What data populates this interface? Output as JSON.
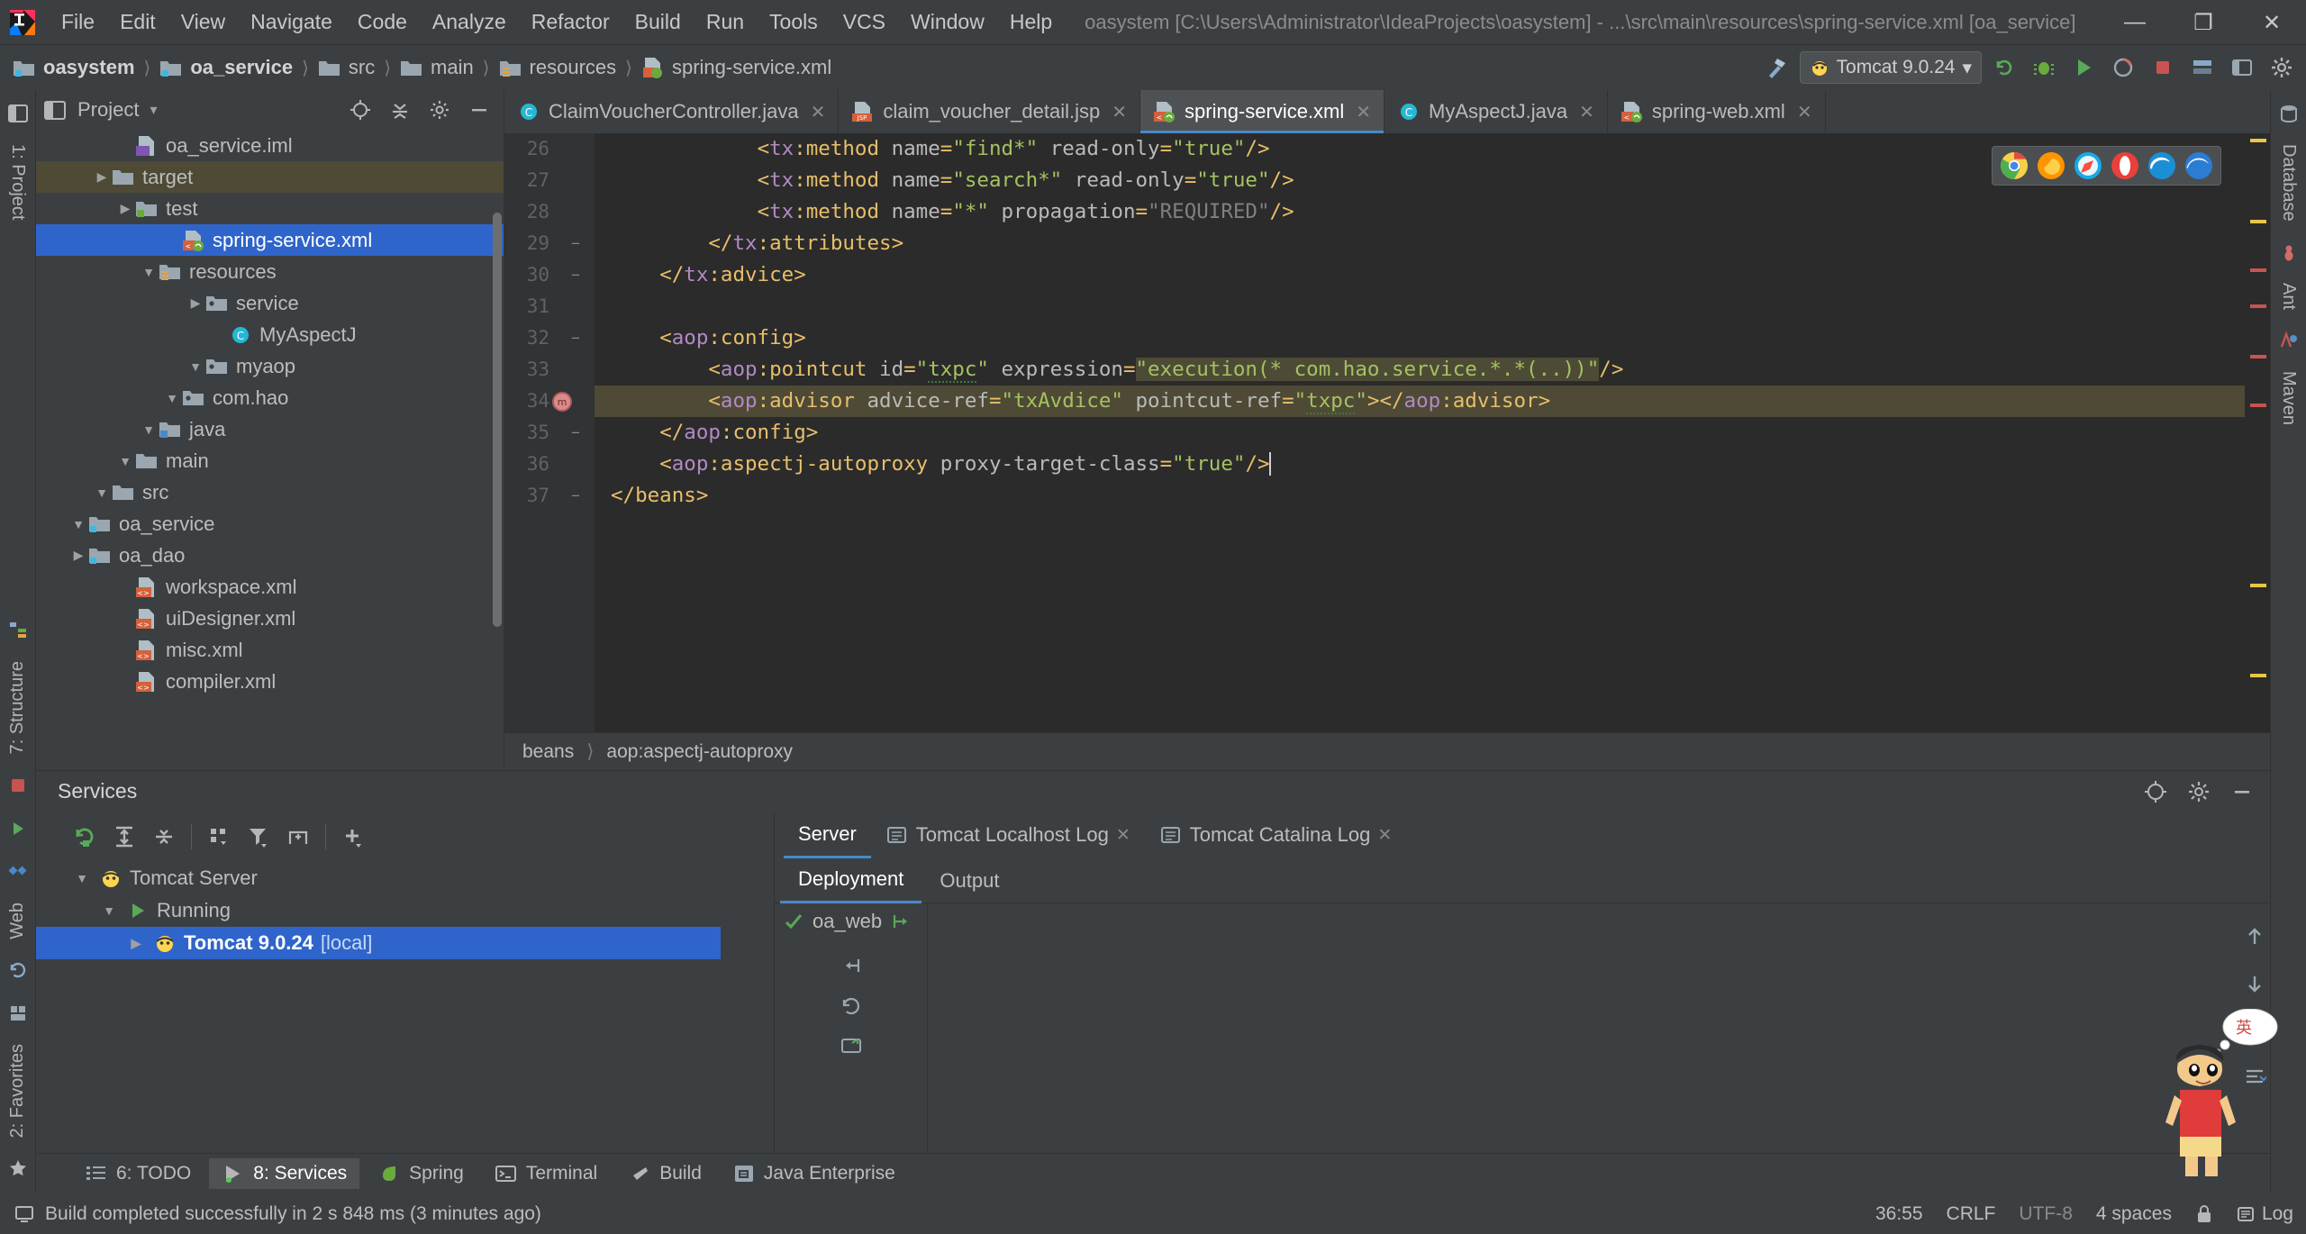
{
  "window": {
    "title": "oasystem [C:\\Users\\Administrator\\IdeaProjects\\oasystem] - ...\\src\\main\\resources\\spring-service.xml [oa_service]",
    "minimize": "—",
    "maximize": "❐",
    "close": "✕"
  },
  "menu": [
    "File",
    "Edit",
    "View",
    "Navigate",
    "Code",
    "Analyze",
    "Refactor",
    "Build",
    "Run",
    "Tools",
    "VCS",
    "Window",
    "Help"
  ],
  "breadcrumb": [
    {
      "label": "oasystem",
      "icon": "module-icon",
      "bold": true
    },
    {
      "label": "oa_service",
      "icon": "module-icon",
      "bold": true
    },
    {
      "label": "src",
      "icon": "folder-icon",
      "bold": false
    },
    {
      "label": "main",
      "icon": "folder-icon",
      "bold": false
    },
    {
      "label": "resources",
      "icon": "resources-folder-icon",
      "bold": false
    },
    {
      "label": "spring-service.xml",
      "icon": "spring-xml-icon",
      "bold": false
    }
  ],
  "toolbar": {
    "run_config": "Tomcat 9.0.24",
    "dropdown_caret": "▾"
  },
  "project_pane": {
    "title": "Project",
    "caret": "▾",
    "tree": [
      {
        "label": "compiler.xml",
        "indent": 3,
        "arrow": "",
        "icon": "xml-icon",
        "state": "normal"
      },
      {
        "label": "misc.xml",
        "indent": 3,
        "arrow": "",
        "icon": "xml-icon",
        "state": "normal"
      },
      {
        "label": "uiDesigner.xml",
        "indent": 3,
        "arrow": "",
        "icon": "xml-icon",
        "state": "normal"
      },
      {
        "label": "workspace.xml",
        "indent": 3,
        "arrow": "",
        "icon": "xml-icon",
        "state": "normal"
      },
      {
        "label": "oa_dao",
        "indent": 1,
        "arrow": "▶",
        "icon": "module-icon",
        "state": "normal"
      },
      {
        "label": "oa_service",
        "indent": 1,
        "arrow": "▼",
        "icon": "module-icon",
        "state": "normal"
      },
      {
        "label": "src",
        "indent": 2,
        "arrow": "▼",
        "icon": "folder-icon",
        "state": "normal"
      },
      {
        "label": "main",
        "indent": 3,
        "arrow": "▼",
        "icon": "folder-icon",
        "state": "normal"
      },
      {
        "label": "java",
        "indent": 4,
        "arrow": "▼",
        "icon": "source-folder-icon",
        "state": "normal"
      },
      {
        "label": "com.hao",
        "indent": 5,
        "arrow": "▼",
        "icon": "package-icon",
        "state": "normal"
      },
      {
        "label": "myaop",
        "indent": 6,
        "arrow": "▼",
        "icon": "package-icon",
        "state": "normal"
      },
      {
        "label": "MyAspectJ",
        "indent": 7,
        "arrow": "",
        "icon": "class-icon",
        "state": "normal"
      },
      {
        "label": "service",
        "indent": 6,
        "arrow": "▶",
        "icon": "package-icon",
        "state": "normal"
      },
      {
        "label": "resources",
        "indent": 4,
        "arrow": "▼",
        "icon": "resources-folder-icon",
        "state": "normal"
      },
      {
        "label": "spring-service.xml",
        "indent": 5,
        "arrow": "",
        "icon": "spring-xml-icon",
        "state": "selected"
      },
      {
        "label": "test",
        "indent": 3,
        "arrow": "▶",
        "icon": "test-folder-icon",
        "state": "normal"
      },
      {
        "label": "target",
        "indent": 2,
        "arrow": "▶",
        "icon": "folder-icon",
        "state": "highlight"
      },
      {
        "label": "oa_service.iml",
        "indent": 3,
        "arrow": "",
        "icon": "iml-icon",
        "state": "normal"
      }
    ]
  },
  "editor": {
    "tabs": [
      {
        "label": "ClaimVoucherController.java",
        "icon": "java-class-icon",
        "active": false,
        "close": "✕"
      },
      {
        "label": "claim_voucher_detail.jsp",
        "icon": "jsp-icon",
        "active": false,
        "close": "✕"
      },
      {
        "label": "spring-service.xml",
        "icon": "spring-xml-icon",
        "active": true,
        "close": "✕"
      },
      {
        "label": "MyAspectJ.java",
        "icon": "java-class-icon",
        "active": false,
        "close": "✕"
      },
      {
        "label": "spring-web.xml",
        "icon": "spring-xml-icon",
        "active": false,
        "close": "✕"
      }
    ],
    "first_line_number": 26,
    "lines": [
      {
        "n": 26,
        "fold": "",
        "hl": false,
        "indent": 12,
        "tokens": [
          {
            "t": "<",
            "c": "tk-punct"
          },
          {
            "t": "tx",
            "c": "tk-ns"
          },
          {
            "t": ":",
            "c": "tk-punct"
          },
          {
            "t": "method",
            "c": "tk-tag"
          },
          {
            "t": " ",
            "c": "tk-attr"
          },
          {
            "t": "name",
            "c": "tk-attr"
          },
          {
            "t": "=",
            "c": "tk-punct"
          },
          {
            "t": "\"find*\"",
            "c": "tk-val"
          },
          {
            "t": " ",
            "c": "tk-attr"
          },
          {
            "t": "read-only",
            "c": "tk-attr"
          },
          {
            "t": "=",
            "c": "tk-punct"
          },
          {
            "t": "\"true\"",
            "c": "tk-val"
          },
          {
            "t": "/>",
            "c": "tk-punct"
          }
        ]
      },
      {
        "n": 27,
        "fold": "",
        "hl": false,
        "indent": 12,
        "tokens": [
          {
            "t": "<",
            "c": "tk-punct"
          },
          {
            "t": "tx",
            "c": "tk-ns"
          },
          {
            "t": ":",
            "c": "tk-punct"
          },
          {
            "t": "method",
            "c": "tk-tag"
          },
          {
            "t": " ",
            "c": "tk-attr"
          },
          {
            "t": "name",
            "c": "tk-attr"
          },
          {
            "t": "=",
            "c": "tk-punct"
          },
          {
            "t": "\"search*\"",
            "c": "tk-val"
          },
          {
            "t": " ",
            "c": "tk-attr"
          },
          {
            "t": "read-only",
            "c": "tk-attr"
          },
          {
            "t": "=",
            "c": "tk-punct"
          },
          {
            "t": "\"true\"",
            "c": "tk-val"
          },
          {
            "t": "/>",
            "c": "tk-punct"
          }
        ]
      },
      {
        "n": 28,
        "fold": "",
        "hl": false,
        "indent": 12,
        "tokens": [
          {
            "t": "<",
            "c": "tk-punct"
          },
          {
            "t": "tx",
            "c": "tk-ns"
          },
          {
            "t": ":",
            "c": "tk-punct"
          },
          {
            "t": "method",
            "c": "tk-tag"
          },
          {
            "t": " ",
            "c": "tk-attr"
          },
          {
            "t": "name",
            "c": "tk-attr"
          },
          {
            "t": "=",
            "c": "tk-punct"
          },
          {
            "t": "\"*\"",
            "c": "tk-val"
          },
          {
            "t": " ",
            "c": "tk-attr"
          },
          {
            "t": "propagation",
            "c": "tk-attr"
          },
          {
            "t": "=",
            "c": "tk-punct"
          },
          {
            "t": "\"REQUIRED\"",
            "c": "tk-gray"
          },
          {
            "t": "/>",
            "c": "tk-punct"
          }
        ]
      },
      {
        "n": 29,
        "fold": "−",
        "hl": false,
        "indent": 8,
        "tokens": [
          {
            "t": "</",
            "c": "tk-punct"
          },
          {
            "t": "tx",
            "c": "tk-ns"
          },
          {
            "t": ":",
            "c": "tk-punct"
          },
          {
            "t": "attributes",
            "c": "tk-tag"
          },
          {
            "t": ">",
            "c": "tk-punct"
          }
        ]
      },
      {
        "n": 30,
        "fold": "−",
        "hl": false,
        "indent": 4,
        "tokens": [
          {
            "t": "</",
            "c": "tk-punct"
          },
          {
            "t": "tx",
            "c": "tk-ns"
          },
          {
            "t": ":",
            "c": "tk-punct"
          },
          {
            "t": "advice",
            "c": "tk-tag"
          },
          {
            "t": ">",
            "c": "tk-punct"
          }
        ]
      },
      {
        "n": 31,
        "fold": "",
        "hl": false,
        "indent": 0,
        "tokens": []
      },
      {
        "n": 32,
        "fold": "−",
        "hl": false,
        "indent": 4,
        "tokens": [
          {
            "t": "<",
            "c": "tk-punct"
          },
          {
            "t": "aop",
            "c": "tk-ns"
          },
          {
            "t": ":",
            "c": "tk-punct"
          },
          {
            "t": "config",
            "c": "tk-tag"
          },
          {
            "t": ">",
            "c": "tk-punct"
          }
        ]
      },
      {
        "n": 33,
        "fold": "",
        "hl": false,
        "indent": 8,
        "tokens": [
          {
            "t": "<",
            "c": "tk-punct"
          },
          {
            "t": "aop",
            "c": "tk-ns"
          },
          {
            "t": ":",
            "c": "tk-punct"
          },
          {
            "t": "pointcut",
            "c": "tk-tag"
          },
          {
            "t": " ",
            "c": "tk-attr"
          },
          {
            "t": "id",
            "c": "tk-attr"
          },
          {
            "t": "=",
            "c": "tk-punct"
          },
          {
            "t": "\"",
            "c": "tk-val"
          },
          {
            "t": "txpc",
            "c": "tk-val squig"
          },
          {
            "t": "\"",
            "c": "tk-val"
          },
          {
            "t": " ",
            "c": "tk-attr"
          },
          {
            "t": "expression",
            "c": "tk-attr"
          },
          {
            "t": "=",
            "c": "tk-punct"
          },
          {
            "t": "\"execution(* com.hao.service.*.*(..))\"",
            "c": "tk-hlval"
          },
          {
            "t": "/>",
            "c": "tk-punct"
          }
        ]
      },
      {
        "n": 34,
        "fold": "",
        "hl": true,
        "indent": 8,
        "breakpoint": true,
        "tokens": [
          {
            "t": "<",
            "c": "tk-punct"
          },
          {
            "t": "aop",
            "c": "tk-ns"
          },
          {
            "t": ":",
            "c": "tk-punct"
          },
          {
            "t": "advisor",
            "c": "tk-tag"
          },
          {
            "t": " ",
            "c": "tk-attr"
          },
          {
            "t": "advice-ref",
            "c": "tk-attr"
          },
          {
            "t": "=",
            "c": "tk-punct"
          },
          {
            "t": "\"txAvdice\"",
            "c": "tk-val"
          },
          {
            "t": " ",
            "c": "tk-attr"
          },
          {
            "t": "pointcut-ref",
            "c": "tk-attr"
          },
          {
            "t": "=",
            "c": "tk-punct"
          },
          {
            "t": "\"",
            "c": "tk-val"
          },
          {
            "t": "txpc",
            "c": "tk-val squig"
          },
          {
            "t": "\"",
            "c": "tk-val"
          },
          {
            "t": "></",
            "c": "tk-punct"
          },
          {
            "t": "aop",
            "c": "tk-ns"
          },
          {
            "t": ":",
            "c": "tk-punct"
          },
          {
            "t": "advisor",
            "c": "tk-tag"
          },
          {
            "t": ">",
            "c": "tk-punct"
          }
        ]
      },
      {
        "n": 35,
        "fold": "−",
        "hl": false,
        "indent": 4,
        "tokens": [
          {
            "t": "</",
            "c": "tk-punct"
          },
          {
            "t": "aop",
            "c": "tk-ns"
          },
          {
            "t": ":",
            "c": "tk-punct"
          },
          {
            "t": "config",
            "c": "tk-tag"
          },
          {
            "t": ">",
            "c": "tk-punct"
          }
        ]
      },
      {
        "n": 36,
        "fold": "",
        "hl": false,
        "indent": 4,
        "tokens": [
          {
            "t": "<",
            "c": "tk-punct"
          },
          {
            "t": "aop",
            "c": "tk-ns"
          },
          {
            "t": ":",
            "c": "tk-punct"
          },
          {
            "t": "aspectj-autoproxy",
            "c": "tk-tag"
          },
          {
            "t": " ",
            "c": "tk-attr"
          },
          {
            "t": "proxy-target-class",
            "c": "tk-attr"
          },
          {
            "t": "=",
            "c": "tk-punct"
          },
          {
            "t": "\"true\"",
            "c": "tk-val"
          },
          {
            "t": "/>",
            "c": "tk-punct"
          }
        ]
      },
      {
        "n": 37,
        "fold": "−",
        "hl": false,
        "indent": 0,
        "tokens": [
          {
            "t": "</",
            "c": "tk-punct"
          },
          {
            "t": "beans",
            "c": "tk-tag"
          },
          {
            "t": ">",
            "c": "tk-punct"
          }
        ]
      }
    ],
    "status_breadcrumb": [
      "beans",
      "aop:aspectj-autoproxy"
    ],
    "browser_icons": [
      "chrome-icon",
      "firefox-icon",
      "safari-icon",
      "opera-icon",
      "edge-legacy-icon",
      "edge-icon"
    ]
  },
  "services": {
    "panel_title": "Services",
    "tree": [
      {
        "label": "Tomcat Server",
        "sub": "",
        "indent": 1,
        "arrow": "▼",
        "icon": "tomcat-icon",
        "state": "normal"
      },
      {
        "label": "Running",
        "sub": "",
        "indent": 2,
        "arrow": "▼",
        "icon": "run-icon",
        "state": "normal"
      },
      {
        "label": "Tomcat 9.0.24",
        "sub": "[local]",
        "indent": 3,
        "arrow": "▶",
        "icon": "tomcat-icon",
        "state": "selected"
      }
    ],
    "tabs": [
      {
        "label": "Server",
        "icon": "",
        "active": true,
        "close": ""
      },
      {
        "label": "Tomcat Localhost Log",
        "icon": "log-icon",
        "active": false,
        "close": "✕"
      },
      {
        "label": "Tomcat Catalina Log",
        "icon": "log-icon",
        "active": false,
        "close": "✕"
      }
    ],
    "subtabs": [
      {
        "label": "Deployment",
        "active": true
      },
      {
        "label": "Output",
        "active": false
      }
    ],
    "deployment_item": {
      "label": "oa_web",
      "status": "deployed"
    }
  },
  "bottom_bar": [
    {
      "label": "6: TODO",
      "icon": "todo-icon",
      "active": false
    },
    {
      "label": "8: Services",
      "icon": "services-icon",
      "active": true
    },
    {
      "label": "Spring",
      "icon": "spring-icon",
      "active": false
    },
    {
      "label": "Terminal",
      "icon": "terminal-icon",
      "active": false
    },
    {
      "label": "Build",
      "icon": "build-icon",
      "active": false
    },
    {
      "label": "Java Enterprise",
      "icon": "javaee-icon",
      "active": false
    }
  ],
  "status": {
    "message": "Build completed successfully in 2 s 848 ms (3 minutes ago)",
    "caret": "36:55",
    "line_ending": "CRLF",
    "encoding": "UTF-8",
    "indent": "4 spaces",
    "lock": "lock-icon",
    "log": "Log"
  },
  "left_strip": [
    {
      "label": "1: Project"
    },
    {
      "label": "2: Favorites"
    },
    {
      "label": "7: Structure"
    },
    {
      "label": "Web"
    }
  ],
  "right_strip": [
    {
      "label": "Database"
    },
    {
      "label": "Ant"
    },
    {
      "label": "Maven"
    }
  ]
}
